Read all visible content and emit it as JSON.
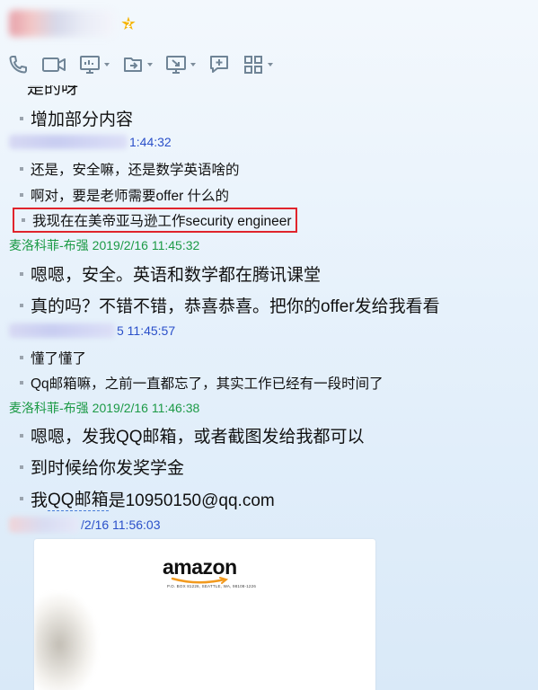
{
  "header": {
    "vip_level": "2",
    "toolbar": [
      {
        "name": "phone-icon",
        "has_caret": false
      },
      {
        "name": "video-icon",
        "has_caret": false
      },
      {
        "name": "screen-share-icon",
        "has_caret": true
      },
      {
        "name": "file-transfer-icon",
        "has_caret": true
      },
      {
        "name": "remote-desktop-icon",
        "has_caret": true
      },
      {
        "name": "message-icon",
        "has_caret": false
      },
      {
        "name": "apps-grid-icon",
        "has_caret": true
      }
    ]
  },
  "chat": {
    "partial_top": "是的呀",
    "msgs_a": [
      "增加部分内容"
    ],
    "sender_b": {
      "visible_time": "1:44:32"
    },
    "msgs_b": [
      "还是，安全嘛，还是数学英语啥的",
      "啊对，要是老师需要offer 什么的",
      "我现在在美帝亚马逊工作security engineer"
    ],
    "sender_c": {
      "name": "麦洛科菲-布强",
      "time": "2019/2/16 11:45:32"
    },
    "msgs_c": [
      "嗯嗯，安全。英语和数学都在腾讯课堂",
      "真的吗？不错不错，恭喜恭喜。把你的offer发给我看看"
    ],
    "sender_d": {
      "visible_time": "5 11:45:57"
    },
    "msgs_d": [
      "懂了懂了",
      "Qq邮箱嘛，之前一直都忘了，其实工作已经有一段时间了"
    ],
    "sender_e": {
      "name": "麦洛科菲-布强",
      "time": "2019/2/16 11:46:38"
    },
    "msgs_e": [
      "嗯嗯，发我QQ邮箱，或者截图发给我都可以",
      "到时候给你发奖学金"
    ],
    "msg_e3": {
      "prefix": "我",
      "link": "QQ邮箱",
      "suffix": "是10950150@qq.com"
    },
    "sender_f": {
      "visible_time": "/2/16 11:56:03"
    },
    "image": {
      "logo": "amazon",
      "address": "P.O. BOX 81226, SEATTLE, WA, 98108-1226"
    }
  },
  "colors": {
    "green_sender": "#1c9a46",
    "blue_sender": "#2a4fc9",
    "highlight": "#e0242c"
  }
}
